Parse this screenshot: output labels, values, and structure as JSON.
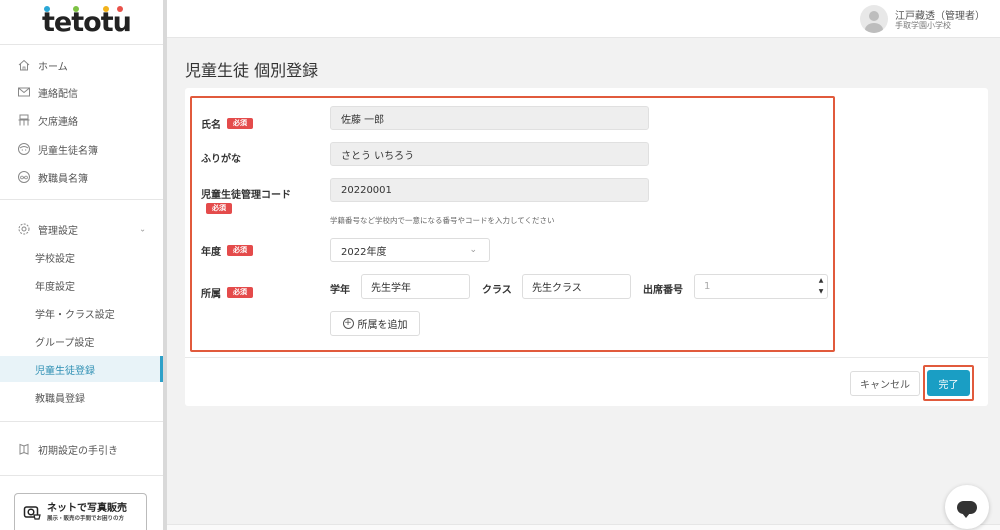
{
  "logo": {
    "letters": [
      {
        "ch": "t",
        "dot": "#2aa7d6"
      },
      {
        "ch": "e",
        "dot": ""
      },
      {
        "ch": "t",
        "dot": "#7dc243"
      },
      {
        "ch": "o",
        "dot": ""
      },
      {
        "ch": "t",
        "dot": "#f2b21b"
      },
      {
        "ch": "u",
        "dot": "#e9524a"
      }
    ]
  },
  "sidebar": {
    "main_items": [
      {
        "label": "ホーム",
        "icon": "home-icon"
      },
      {
        "label": "連絡配信",
        "icon": "mail-icon"
      },
      {
        "label": "欠席連絡",
        "icon": "desk-icon"
      },
      {
        "label": "児童生徒名簿",
        "icon": "student-face-icon"
      },
      {
        "label": "教職員名簿",
        "icon": "teacher-face-icon"
      }
    ],
    "settings": {
      "label": "管理設定",
      "icon": "gear-icon"
    },
    "sub_items": [
      {
        "label": "学校設定",
        "active": false
      },
      {
        "label": "年度設定",
        "active": false
      },
      {
        "label": "学年・クラス設定",
        "active": false
      },
      {
        "label": "グループ設定",
        "active": false
      },
      {
        "label": "児童生徒登録",
        "active": true
      },
      {
        "label": "教職員登録",
        "active": false
      }
    ],
    "guide": {
      "label": "初期設定の手引き",
      "icon": "book-icon"
    },
    "promo": {
      "title": "ネットで写真販売",
      "subtitle": "展示・販売の手間でお困りの方"
    }
  },
  "header": {
    "user_name": "江戸藏透（管理者）",
    "school": "手取学園小学校"
  },
  "page": {
    "title": "児童生徒 個別登録"
  },
  "form": {
    "required_label": "必須",
    "name_label": "氏名",
    "name_value": "佐藤 一郎",
    "kana_label": "ふりがな",
    "kana_value": "さとう いちろう",
    "code_label": "児童生徒管理コード",
    "code_value": "20220001",
    "code_hint": "学籍番号など学校内で一意になる番号やコードを入力してください",
    "year_label": "年度",
    "year_value": "2022年度",
    "affiliation_label": "所属",
    "grade_label": "学年",
    "grade_value": "先生学年",
    "class_label": "クラス",
    "class_value": "先生クラス",
    "attendance_label": "出席番号",
    "attendance_value": "1",
    "add_affiliation": "所属を追加"
  },
  "actions": {
    "cancel": "キャンセル",
    "done": "完了"
  },
  "colors": {
    "accent": "#1a9ec4",
    "highlight": "#e15a3c",
    "required": "#e44b4b"
  }
}
